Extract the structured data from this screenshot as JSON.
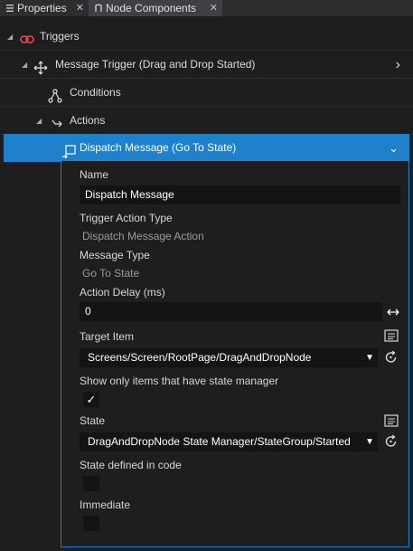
{
  "tabs": [
    {
      "label": "Properties",
      "active": false
    },
    {
      "label": "Node Components",
      "active": true
    }
  ],
  "tree": {
    "triggers": "Triggers",
    "message_trigger": "Message Trigger (Drag and Drop Started)",
    "conditions": "Conditions",
    "actions": "Actions",
    "dispatch": "Dispatch Message (Go To State)"
  },
  "panel": {
    "name_label": "Name",
    "name_value": "Dispatch Message",
    "trigger_action_type_label": "Trigger Action Type",
    "trigger_action_type_value": "Dispatch Message Action",
    "message_type_label": "Message Type",
    "message_type_value": "Go To State",
    "action_delay_label": "Action Delay (ms)",
    "action_delay_value": "0",
    "target_item_label": "Target Item",
    "target_item_value": "Screens/Screen/RootPage/DragAndDropNode",
    "show_only_label": "Show only items that have state manager",
    "show_only_checked": true,
    "state_label": "State",
    "state_value": "DragAndDropNode State Manager/StateGroup/Started",
    "state_in_code_label": "State defined in code",
    "state_in_code_checked": false,
    "immediate_label": "Immediate",
    "immediate_checked": false
  },
  "colors": {
    "accent": "#1f80cc",
    "background": "#1e1e1e",
    "field": "#141414",
    "trigger_icon": "#e05050"
  },
  "icons": {
    "triggers": "trigger-link-icon",
    "message_trigger": "move-arrows-icon",
    "conditions": "condition-nodes-icon",
    "actions": "action-arrow-icon",
    "dispatch": "dispatch-message-icon"
  }
}
